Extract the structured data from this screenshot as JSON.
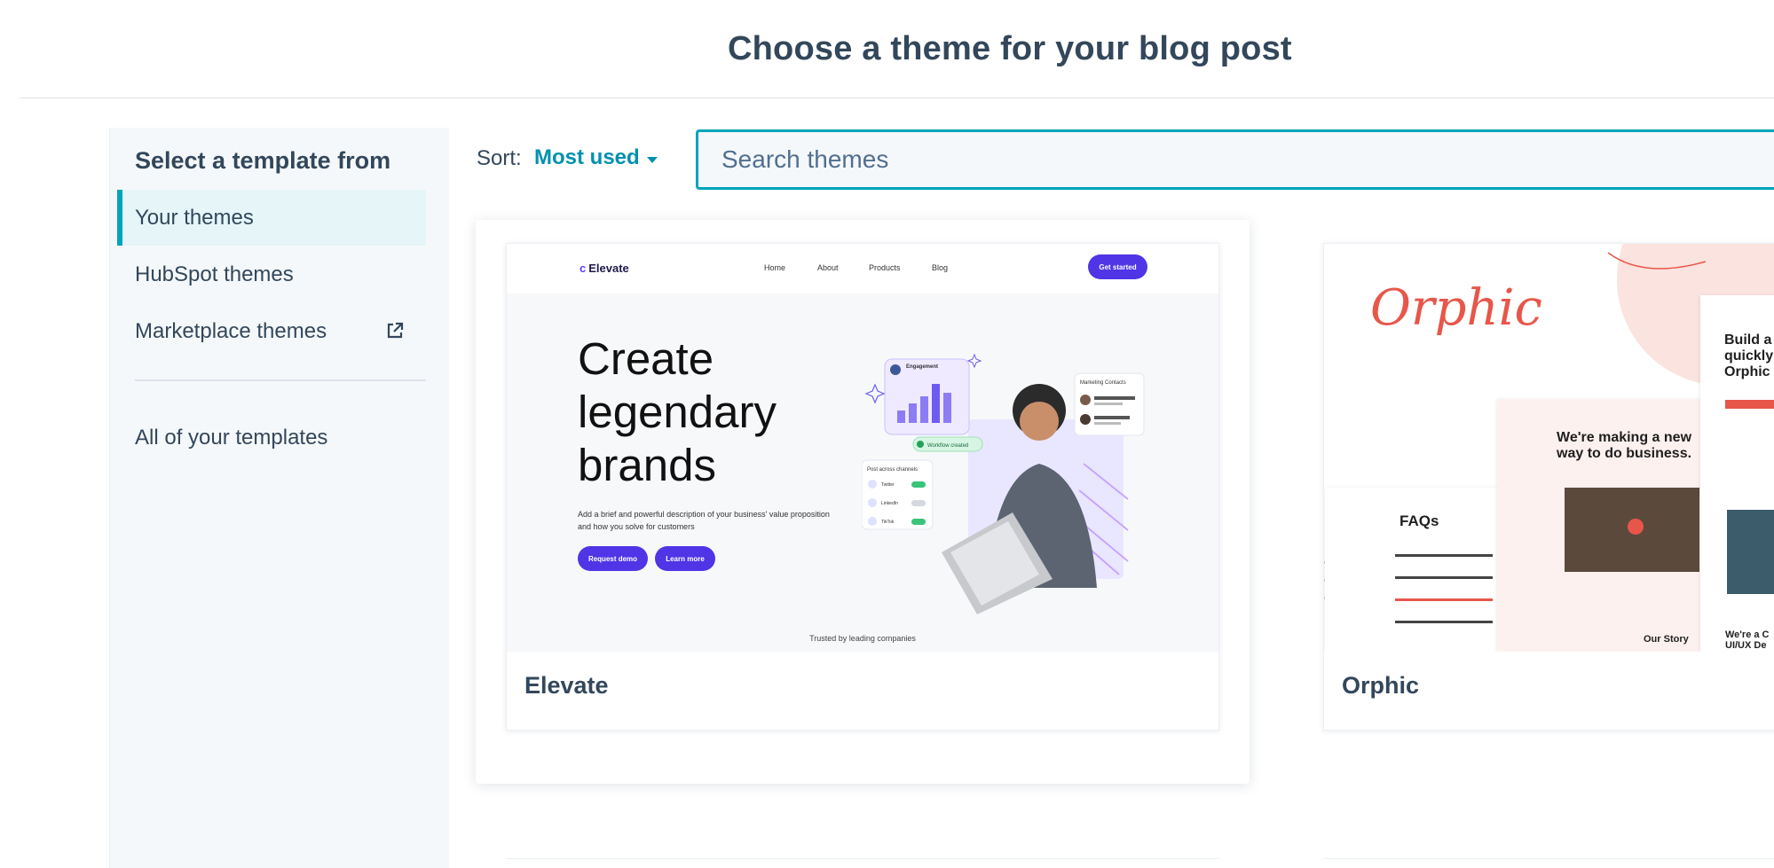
{
  "header": {
    "title": "Choose a theme for your blog post"
  },
  "sidebar": {
    "heading": "Select a template from",
    "items": [
      {
        "label": "Your themes",
        "active": true
      },
      {
        "label": "HubSpot themes",
        "active": false
      },
      {
        "label": "Marketplace themes",
        "active": false,
        "icon": "external-link-icon"
      }
    ],
    "all_templates": "All of your templates"
  },
  "toolbar": {
    "sort_label": "Sort:",
    "sort_value": "Most used",
    "search_placeholder": "Search themes"
  },
  "themes": [
    {
      "name": "Elevate",
      "preview": {
        "logo": "Elevate",
        "nav": [
          "Home",
          "About",
          "Products",
          "Blog"
        ],
        "cta": "Get started",
        "hero": [
          "Create",
          "legendary",
          "brands"
        ],
        "description": "Add a brief and powerful description of your business' value proposition and how you solve for customers",
        "buttons": [
          "Request demo",
          "Learn more"
        ],
        "trusted": "Trusted by leading companies",
        "widgets": {
          "chart_label": "Engagement",
          "status": "Workflow created",
          "contacts_title": "Marketing Contacts",
          "channels_title": "Post across channels",
          "channels": [
            "Twitter",
            "LinkedIn",
            "TikTok"
          ]
        }
      }
    },
    {
      "name": "Orphic",
      "preview": {
        "logo": "Orphic",
        "headline": [
          "We're making a new",
          "way to do business."
        ],
        "faq": "FAQs",
        "story": "Our Story",
        "build": [
          "Build a",
          "quickly",
          "Orphic"
        ],
        "footer_line": [
          "We're a C",
          "UI/UX De"
        ]
      }
    }
  ],
  "colors": {
    "accent": "#00a4bd",
    "link": "#0091ae",
    "text": "#33475b",
    "elevate_brand": "#4f35e6",
    "orphic_brand": "#e8564a"
  }
}
